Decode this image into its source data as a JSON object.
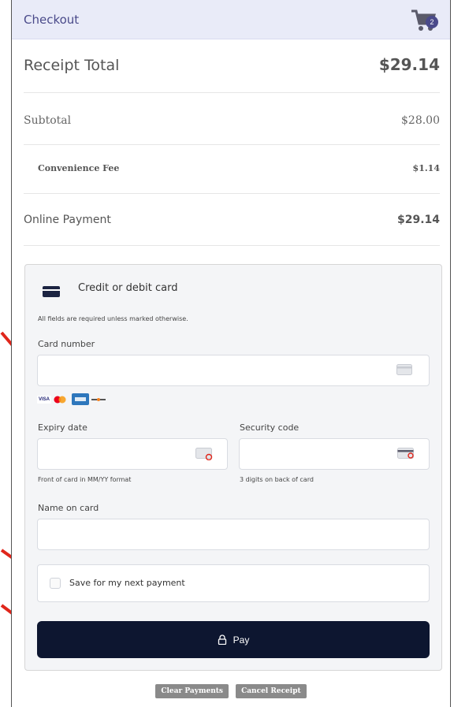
{
  "header": {
    "title": "Checkout",
    "cart_count": "2"
  },
  "summary": {
    "receipt_total_label": "Receipt Total",
    "receipt_total_value": "$29.14",
    "subtotal_label": "Subtotal",
    "subtotal_value": "$28.00",
    "fee_label": "Convenience Fee",
    "fee_value": "$1.14",
    "online_payment_label": "Online Payment",
    "online_payment_value": "$29.14"
  },
  "card_form": {
    "title": "Credit or debit card",
    "required_note": "All fields are required unless marked otherwise.",
    "card_number_label": "Card number",
    "card_number_value": "",
    "brands": [
      "VISA",
      "mastercard",
      "amex",
      "DISCOVER"
    ],
    "expiry_label": "Expiry date",
    "expiry_value": "",
    "expiry_hint": "Front of card in MM/YY format",
    "security_label": "Security code",
    "security_value": "",
    "security_hint": "3 digits on back of card",
    "name_label": "Name on card",
    "name_value": "",
    "save_label": "Save for my next payment",
    "save_checked": false,
    "pay_label": "Pay"
  },
  "actions": {
    "clear_label": "Clear Payments",
    "cancel_label": "Cancel Receipt"
  },
  "colors": {
    "header_bg": "#e9ebf8",
    "pay_button": "#0d1630",
    "annotation_arrow": "#e0261b",
    "small_button": "#8a8a8a"
  },
  "icons": [
    "shopping-cart-icon",
    "credit-card-icon",
    "lock-icon",
    "card-placeholder-icon",
    "card-front-icon",
    "card-back-icon"
  ]
}
